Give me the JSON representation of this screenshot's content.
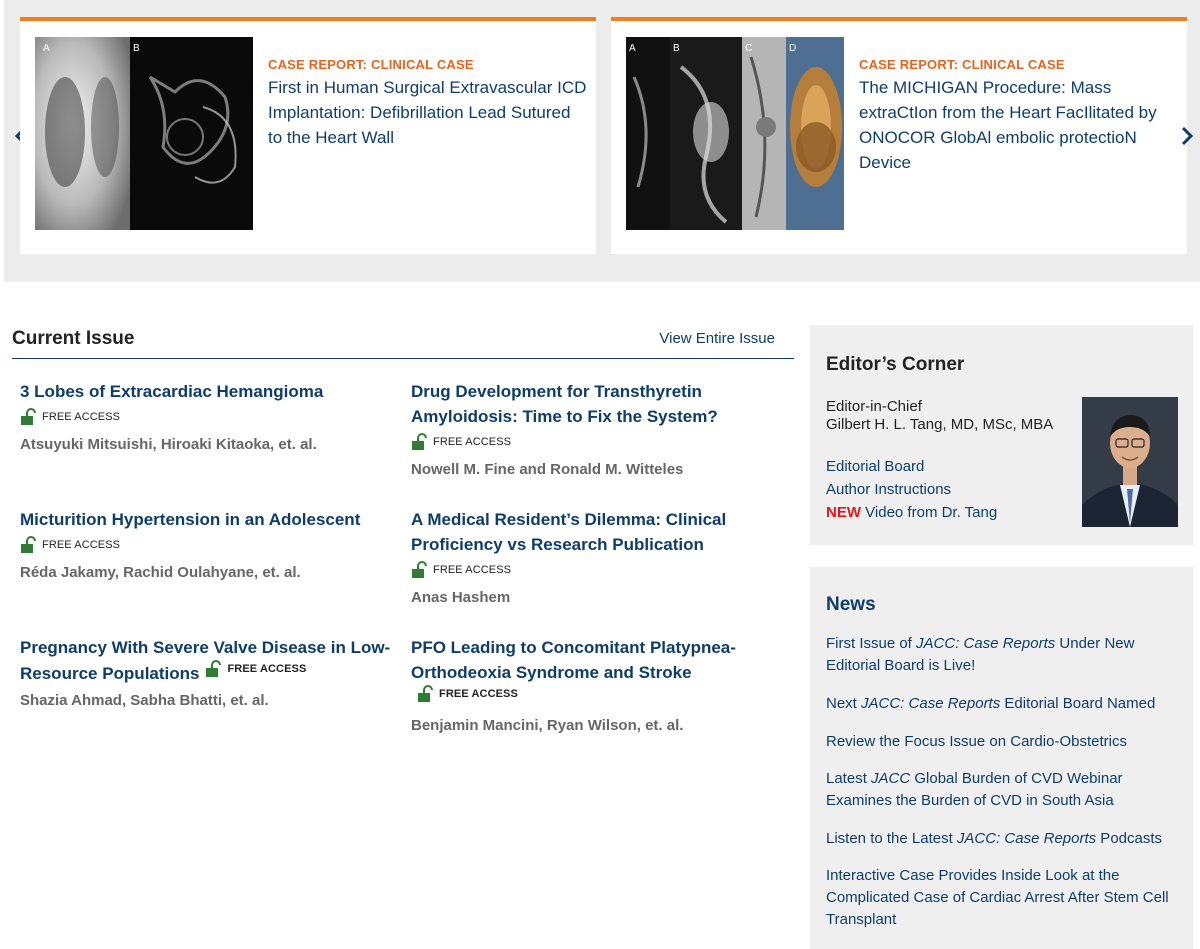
{
  "carousel": {
    "cards": [
      {
        "kicker": "CASE REPORT: CLINICAL CASE",
        "title": "First in Human Surgical Extravascular ICD Implantation: Defibrillation Lead Sutured to the Heart Wall",
        "image_labels": [
          "A",
          "B"
        ]
      },
      {
        "kicker": "CASE REPORT: CLINICAL CASE",
        "title": "The MICHIGAN Procedure: Mass extraCtIon from the Heart FacIlitated by ONOCOR GlobAl embolic protectioN Device",
        "image_labels": [
          "A",
          "B",
          "C",
          "D"
        ]
      }
    ],
    "prev_icon": "chevron-left-icon",
    "next_icon": "chevron-right-icon"
  },
  "current_issue": {
    "heading": "Current Issue",
    "view_all": "View Entire Issue",
    "free_access_label": "FREE ACCESS",
    "articles": [
      {
        "title": "3 Lobes of Extracardiac Hemangioma",
        "authors": "Atsuyuki Mitsuishi, Hiroaki Kitaoka, et. al."
      },
      {
        "title": "Drug Development for Transthyretin Amyloidosis: Time to Fix the System?",
        "authors": "Nowell M. Fine and Ronald M. Witteles"
      },
      {
        "title": "Micturition Hypertension in an Adolescent",
        "authors": "Réda Jakamy, Rachid Oulahyane, et. al."
      },
      {
        "title": "A Medical Resident’s Dilemma: Clinical Proficiency vs Research Publication",
        "authors": "Anas Hashem"
      },
      {
        "title": "Pregnancy With Severe Valve Disease in Low-Resource Populations",
        "authors": "Shazia Ahmad, Sabha Bhatti, et. al."
      },
      {
        "title": "PFO Leading to Concomitant Platypnea-Orthodeoxia Syndrome and Stroke",
        "authors": "Benjamin Mancini, Ryan Wilson, et. al."
      }
    ]
  },
  "editors_corner": {
    "heading": "Editor’s Corner",
    "role": "Editor-in-Chief",
    "name": "Gilbert H. L. Tang, MD, MSc, MBA",
    "editorial_board": "Editorial Board",
    "author_instructions": "Author Instructions",
    "new_badge": "NEW",
    "video_link": "Video from Dr. Tang"
  },
  "news": {
    "heading": "News",
    "items": [
      {
        "pre": "First Issue of ",
        "em": "JACC: Case Reports",
        "post": " Under New Editorial Board is Live!"
      },
      {
        "pre": "Next ",
        "em": "JACC: Case Reports",
        "post": " Editorial Board Named"
      },
      {
        "pre": "Review the Focus Issue on Cardio-Obstetrics",
        "em": "",
        "post": ""
      },
      {
        "pre": "Latest ",
        "em": "JACC",
        "post": " Global Burden of CVD Webinar Examines the Burden of CVD in South Asia"
      },
      {
        "pre": "Listen to the Latest ",
        "em": "JACC: Case Reports",
        "post": " Podcasts"
      },
      {
        "pre": "Interactive Case Provides Inside Look at the Complicated Case of Cardiac Arrest After Stem Cell Transplant",
        "em": "",
        "post": ""
      }
    ]
  },
  "colors": {
    "accent": "#ef7d22",
    "link": "#0e3d6b",
    "free_access": "#2e7d32",
    "new": "#e8141c"
  }
}
